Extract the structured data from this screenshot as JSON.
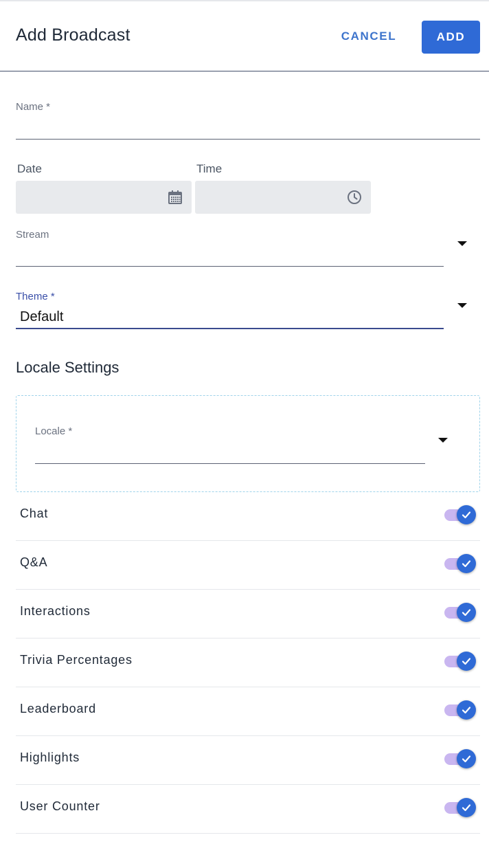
{
  "header": {
    "title": "Add Broadcast",
    "cancel_label": "CANCEL",
    "add_label": "ADD"
  },
  "form": {
    "name": {
      "label": "Name *",
      "value": ""
    },
    "date": {
      "label": "Date",
      "value": "",
      "icon": "calendar-icon"
    },
    "time": {
      "label": "Time",
      "value": "",
      "icon": "clock-icon"
    },
    "stream": {
      "label": "Stream",
      "value": ""
    },
    "theme": {
      "label": "Theme *",
      "value": "Default"
    }
  },
  "locale_settings": {
    "title": "Locale Settings",
    "locale": {
      "label": "Locale *",
      "value": ""
    }
  },
  "toggles": [
    {
      "label": "Chat",
      "checked": true
    },
    {
      "label": "Q&A",
      "checked": true
    },
    {
      "label": "Interactions",
      "checked": true
    },
    {
      "label": "Trivia Percentages",
      "checked": true
    },
    {
      "label": "Leaderboard",
      "checked": true
    },
    {
      "label": "Highlights",
      "checked": true
    },
    {
      "label": "User Counter",
      "checked": true
    }
  ],
  "colors": {
    "primary": "#2f6ad6",
    "track": "#c9b6f0",
    "focus": "#3a4fa8"
  }
}
